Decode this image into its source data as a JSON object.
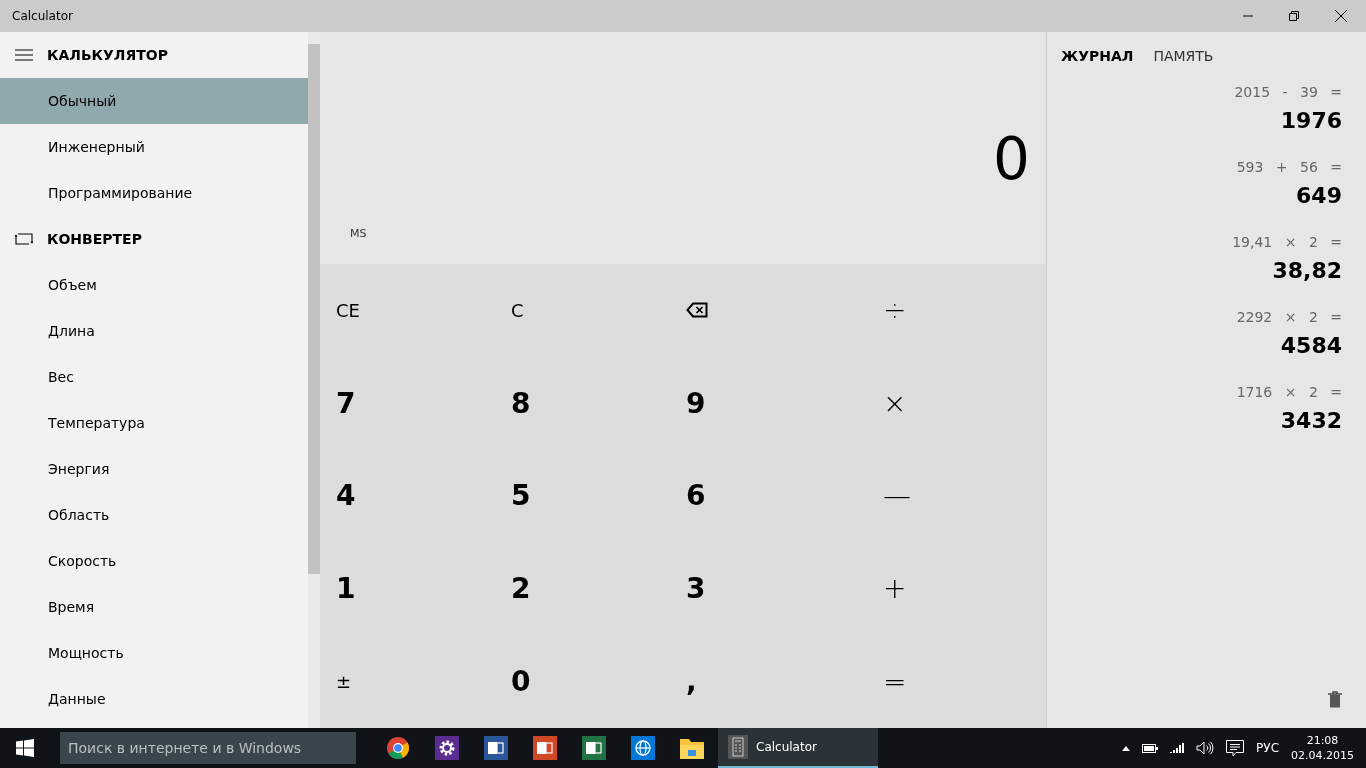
{
  "window": {
    "title": "Calculator"
  },
  "sidebar": {
    "sections": [
      {
        "kind": "calculator",
        "heading": "КАЛЬКУЛЯТОР",
        "items": [
          {
            "label": "Обычный",
            "selected": true
          },
          {
            "label": "Инженерный",
            "selected": false
          },
          {
            "label": "Программирование",
            "selected": false
          }
        ]
      },
      {
        "kind": "converter",
        "heading": "КОНВЕРТЕР",
        "items": [
          {
            "label": "Объем",
            "selected": false
          },
          {
            "label": "Длина",
            "selected": false
          },
          {
            "label": "Вес",
            "selected": false
          },
          {
            "label": "Температура",
            "selected": false
          },
          {
            "label": "Энергия",
            "selected": false
          },
          {
            "label": "Область",
            "selected": false
          },
          {
            "label": "Скорость",
            "selected": false
          },
          {
            "label": "Время",
            "selected": false
          },
          {
            "label": "Мощность",
            "selected": false
          },
          {
            "label": "Данные",
            "selected": false
          }
        ]
      }
    ]
  },
  "display": {
    "value": "0",
    "memory_button": "MS"
  },
  "keypad": [
    {
      "kind": "text",
      "label": "CE"
    },
    {
      "kind": "text",
      "label": "C"
    },
    {
      "kind": "backspace"
    },
    {
      "kind": "op",
      "label": "÷"
    },
    {
      "kind": "digit",
      "label": "7"
    },
    {
      "kind": "digit",
      "label": "8"
    },
    {
      "kind": "digit",
      "label": "9"
    },
    {
      "kind": "op",
      "label": "×"
    },
    {
      "kind": "digit",
      "label": "4"
    },
    {
      "kind": "digit",
      "label": "5"
    },
    {
      "kind": "digit",
      "label": "6"
    },
    {
      "kind": "op",
      "label": "—"
    },
    {
      "kind": "digit",
      "label": "1"
    },
    {
      "kind": "digit",
      "label": "2"
    },
    {
      "kind": "digit",
      "label": "3"
    },
    {
      "kind": "op",
      "label": "+"
    },
    {
      "kind": "text",
      "label": "±"
    },
    {
      "kind": "digit",
      "label": "0"
    },
    {
      "kind": "digit",
      "label": ","
    },
    {
      "kind": "op",
      "label": "="
    }
  ],
  "panel": {
    "tabs": [
      {
        "label": "ЖУРНАЛ",
        "selected": true
      },
      {
        "label": "ПАМЯТЬ",
        "selected": false
      }
    ],
    "history": [
      {
        "expression": "2015 - 39 =",
        "result": "1976"
      },
      {
        "expression": "593 + 56 =",
        "result": "649"
      },
      {
        "expression": "19,41 × 2 =",
        "result": "38,82"
      },
      {
        "expression": "2292 × 2 =",
        "result": "4584"
      },
      {
        "expression": "1716 × 2 =",
        "result": "3432"
      }
    ]
  },
  "taskbar": {
    "search": {
      "placeholder": "Поиск в интернете и в Windows"
    },
    "apps": [
      {
        "kind": "chrome"
      },
      {
        "kind": "settings"
      },
      {
        "kind": "word"
      },
      {
        "kind": "powerpoint"
      },
      {
        "kind": "excel"
      },
      {
        "kind": "globe"
      },
      {
        "kind": "folder"
      }
    ],
    "active_task": {
      "label": "Calculator"
    },
    "language": "РУС",
    "time": "21:08",
    "date": "02.04.2015"
  }
}
